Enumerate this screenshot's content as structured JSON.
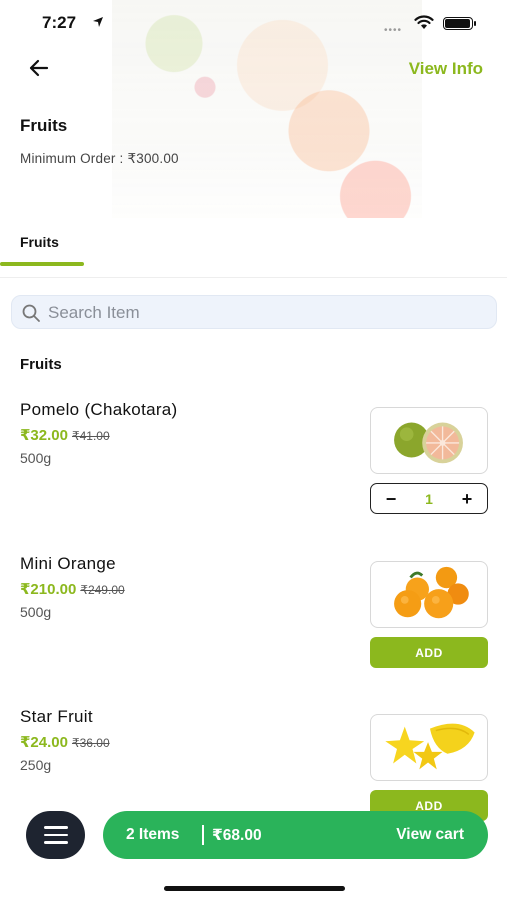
{
  "status_bar": {
    "time": "7:27"
  },
  "header": {
    "view_info_label": "View Info"
  },
  "store": {
    "title": "Fruits",
    "minimum_order": "Minimum Order : ₹300.00"
  },
  "tabs": [
    {
      "label": "Fruits",
      "active": true
    }
  ],
  "search": {
    "placeholder": "Search Item",
    "value": ""
  },
  "section": {
    "heading": "Fruits"
  },
  "products": [
    {
      "name": "Pomelo (Chakotara)",
      "price": "₹32.00",
      "mrp": "₹41.00",
      "quantity": "500g",
      "in_cart": true,
      "cart_qty": "1",
      "image": "pomelo"
    },
    {
      "name": "Mini Orange",
      "price": "₹210.00",
      "mrp": "₹249.00",
      "quantity": "500g",
      "in_cart": false,
      "add_label": "ADD",
      "image": "mini-orange"
    },
    {
      "name": "Star Fruit",
      "price": "₹24.00",
      "mrp": "₹36.00",
      "quantity": "250g",
      "in_cart": false,
      "add_label": "ADD",
      "image": "star-fruit"
    }
  ],
  "stepper": {
    "minus": "−",
    "plus": "+"
  },
  "cart": {
    "items": "2 Items",
    "total": "₹68.00",
    "view_label": "View cart"
  },
  "colors": {
    "accent": "#8cb81e",
    "cart_green": "#2ab35a",
    "fab_dark": "#1e2430"
  }
}
